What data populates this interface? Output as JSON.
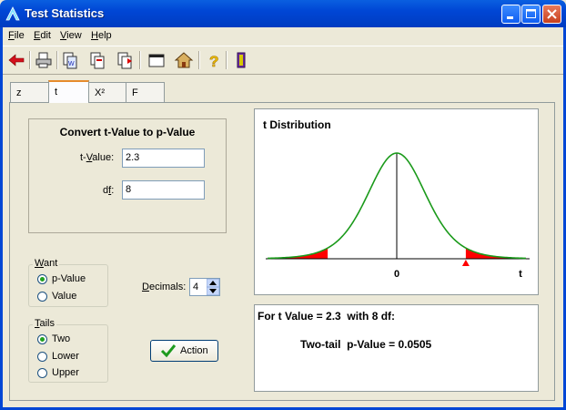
{
  "window": {
    "title": "Test Statistics"
  },
  "menu": [
    {
      "label": "File",
      "accel": "F",
      "rest": "ile"
    },
    {
      "label": "Edit",
      "accel": "E",
      "rest": "dit"
    },
    {
      "label": "View",
      "accel": "V",
      "rest": "iew"
    },
    {
      "label": "Help",
      "accel": "H",
      "rest": "elp"
    }
  ],
  "toolbar": {
    "icons": [
      "back-arrow-icon",
      "print-icon",
      "copy-icon",
      "paste-icon",
      "export-icon",
      "window-icon",
      "home-icon",
      "help-icon",
      "exit-icon"
    ]
  },
  "tabs": [
    {
      "label": "z"
    },
    {
      "label": "t"
    },
    {
      "label": "X²"
    },
    {
      "label": "F"
    }
  ],
  "convert": {
    "title": "Convert t-Value to p-Value",
    "tvalue_label": "t-Value:",
    "tvalue": "2.3",
    "df_label": "df:",
    "df": "8"
  },
  "want": {
    "legend": "Want",
    "options": [
      "p-Value",
      "Value"
    ],
    "selected": "p-Value"
  },
  "tails": {
    "legend": "Tails",
    "options": [
      "Two",
      "Lower",
      "Upper"
    ],
    "selected": "Two"
  },
  "decimals": {
    "label": "Decimals:",
    "value": "4"
  },
  "action": {
    "label": "Action"
  },
  "chart": {
    "title": "t Distribution",
    "axis_labels": [
      "0",
      "t"
    ],
    "t_value": 2.3,
    "df": 8,
    "curve_color": "#1a9a1a",
    "tail_color": "#ff0000"
  },
  "result": {
    "line1": "For t Value = 2.3  with 8 df:",
    "line2": "Two-tail  p-Value = 0.0505"
  }
}
